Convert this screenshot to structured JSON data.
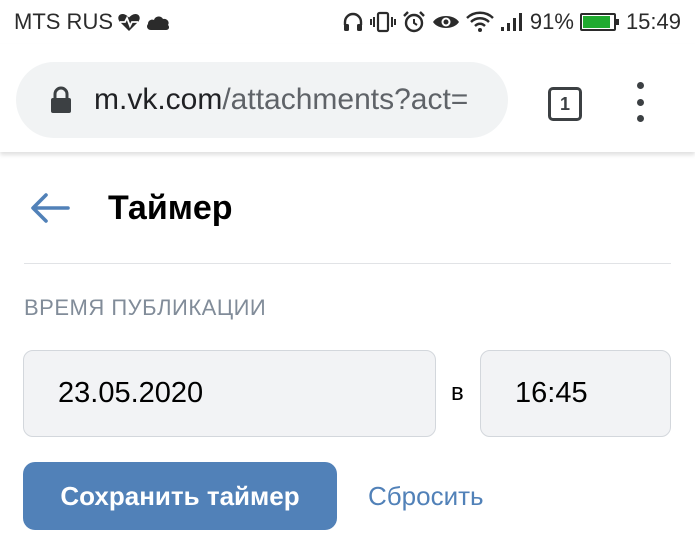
{
  "status_bar": {
    "carrier": "MTS RUS",
    "battery_percent": "91%",
    "battery_level": 0.91,
    "time": "15:49",
    "icons": [
      "heart-pulse-icon",
      "cloud-icon",
      "headphones-icon",
      "vibrate-icon",
      "alarm-icon",
      "eye-icon",
      "wifi-icon",
      "signal-icon",
      "battery-icon"
    ],
    "battery_color": "#1faa2f"
  },
  "browser": {
    "url_host": "m.vk.com",
    "url_path": "/attachments?act=",
    "tabs_count": "1",
    "icons": [
      "lock-icon",
      "tabs-icon",
      "more-vert-icon"
    ]
  },
  "page": {
    "title": "Таймер",
    "section_label": "ВРЕМЯ ПУБЛИКАЦИИ",
    "date_value": "23.05.2020",
    "at_label": "в",
    "time_value": "16:45",
    "save_label": "Сохранить таймер",
    "reset_label": "Сбросить",
    "accent_color": "#5181b8"
  }
}
